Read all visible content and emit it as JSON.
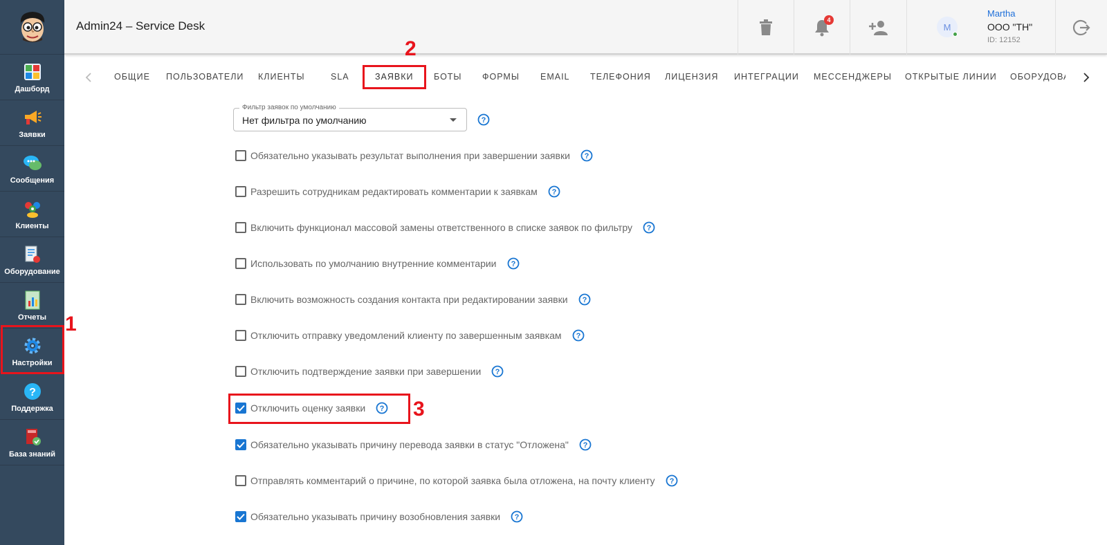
{
  "sidebar": {
    "items": [
      {
        "label": "Дашборд",
        "icon": "dashboard-icon"
      },
      {
        "label": "Заявки",
        "icon": "megaphone-icon"
      },
      {
        "label": "Сообщения",
        "icon": "chat-bubbles-icon"
      },
      {
        "label": "Клиенты",
        "icon": "people-icon"
      },
      {
        "label": "Оборудование",
        "icon": "equipment-icon"
      },
      {
        "label": "Отчеты",
        "icon": "report-chart-icon"
      },
      {
        "label": "Настройки",
        "icon": "gear-icon"
      },
      {
        "label": "Поддержка",
        "icon": "question-icon"
      },
      {
        "label": "База знаний",
        "icon": "book-icon"
      }
    ]
  },
  "header": {
    "title": "Admin24 – Service Desk",
    "notifications_count": "4",
    "user": {
      "avatar_letter": "M",
      "name": "Martha",
      "org": "ООО \"ТН\"",
      "id": "ID: 12152"
    }
  },
  "tabs": {
    "items": [
      "ОБЩИЕ",
      "ПОЛЬЗОВАТЕЛИ",
      "КЛИЕНТЫ",
      "SLA",
      "ЗАЯВКИ",
      "БОТЫ",
      "ФОРМЫ",
      "EMAIL",
      "ТЕЛЕФОНИЯ",
      "ЛИЦЕНЗИЯ",
      "ИНТЕГРАЦИИ",
      "МЕССЕНДЖЕРЫ",
      "ОТКРЫТЫЕ ЛИНИИ",
      "ОБОРУДОВАН"
    ],
    "active": "ЗАЯВКИ"
  },
  "filter": {
    "label": "Фильтр заявок по умолчанию",
    "value": "Нет фильтра по умолчанию"
  },
  "options": [
    {
      "label": "Обязательно указывать результат выполнения при завершении заявки",
      "checked": false
    },
    {
      "label": "Разрешить сотрудникам редактировать комментарии к заявкам",
      "checked": false
    },
    {
      "label": "Включить функционал массовой замены ответственного в списке заявок по фильтру",
      "checked": false
    },
    {
      "label": "Использовать по умолчанию внутренние комментарии",
      "checked": false
    },
    {
      "label": "Включить возможность создания контакта при редактировании заявки",
      "checked": false
    },
    {
      "label": "Отключить отправку уведомлений клиенту по завершенным заявкам",
      "checked": false
    },
    {
      "label": "Отключить подтверждение заявки при завершении",
      "checked": false
    },
    {
      "label": "Отключить оценку заявки",
      "checked": true
    },
    {
      "label": "Обязательно указывать причину перевода заявки в статус \"Отложена\"",
      "checked": true
    },
    {
      "label": "Отправлять комментарий о причине, по которой заявка была отложена, на почту клиенту",
      "checked": false
    },
    {
      "label": "Обязательно указывать причину возобновления заявки",
      "checked": true
    }
  ],
  "annotations": [
    "1",
    "2",
    "3"
  ],
  "colors": {
    "sidebar": "#34495e",
    "accent": "#1976d2",
    "annotation": "#e8141c"
  }
}
